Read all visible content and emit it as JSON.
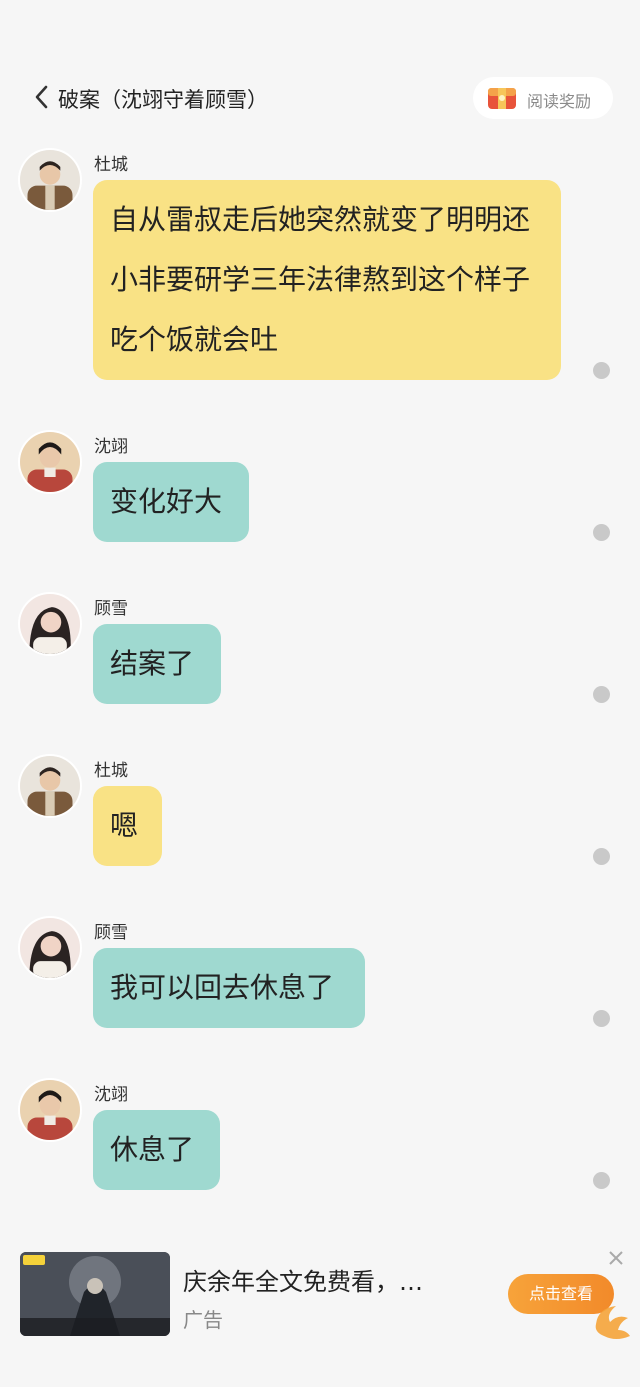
{
  "header": {
    "title": "破案（沈翊守着顾雪）",
    "reward_label": "阅读奖励"
  },
  "messages": [
    {
      "sender": "杜城",
      "text": "自从雷叔走后她突然就变了明明还小非要研学三年法律熬到这个样子吃个饭就会吐",
      "color": "yellow"
    },
    {
      "sender": "沈翊",
      "text": "变化好大",
      "color": "teal"
    },
    {
      "sender": "顾雪",
      "text": "结案了",
      "color": "teal"
    },
    {
      "sender": "杜城",
      "text": "嗯",
      "color": "yellow"
    },
    {
      "sender": "顾雪",
      "text": "我可以回去休息了",
      "color": "teal"
    },
    {
      "sender": "沈翊",
      "text": "休息了",
      "color": "teal"
    }
  ],
  "ad": {
    "title": "庆余年全文免费看，…",
    "label": "广告",
    "cta": "点击查看"
  },
  "colors": {
    "background": "#f6f6f6",
    "bubble_yellow": "#f9e285",
    "bubble_teal": "#9fd9d0",
    "cta_orange": "#f39a32"
  }
}
